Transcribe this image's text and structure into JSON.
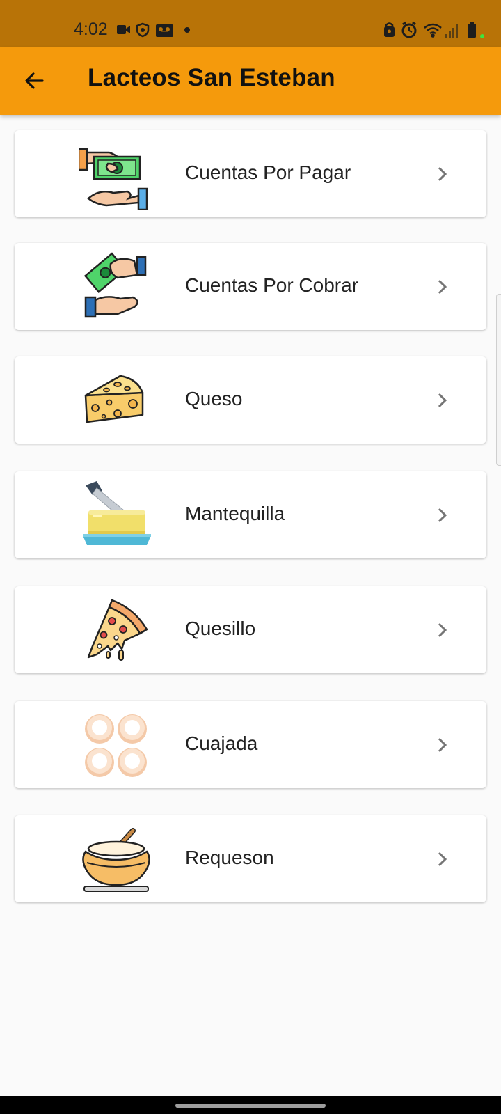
{
  "status_bar": {
    "time": "4:02",
    "left_icons": [
      "video-camera-icon",
      "shield-icon",
      "voicemail-icon",
      "dot-icon"
    ],
    "right_icons": [
      "lock-icon",
      "alarm-icon",
      "wifi-icon",
      "signal-icon",
      "battery-icon"
    ],
    "colors": {
      "background": "#b87307"
    }
  },
  "app_bar": {
    "title": "Lacteos San Esteban",
    "back_icon": "arrow-back-icon",
    "colors": {
      "background": "#f59a0c"
    }
  },
  "menu": {
    "items": [
      {
        "label": "Cuentas Por Pagar",
        "icon": "pay-money-hands-icon"
      },
      {
        "label": "Cuentas Por Cobrar",
        "icon": "receive-money-hands-icon"
      },
      {
        "label": "Queso",
        "icon": "cheese-icon"
      },
      {
        "label": "Mantequilla",
        "icon": "butter-icon"
      },
      {
        "label": "Quesillo",
        "icon": "pizza-slice-icon"
      },
      {
        "label": "Cuajada",
        "icon": "curd-rolls-icon"
      },
      {
        "label": "Requeson",
        "icon": "pot-icon"
      }
    ],
    "chevron_icon": "chevron-right-icon"
  }
}
